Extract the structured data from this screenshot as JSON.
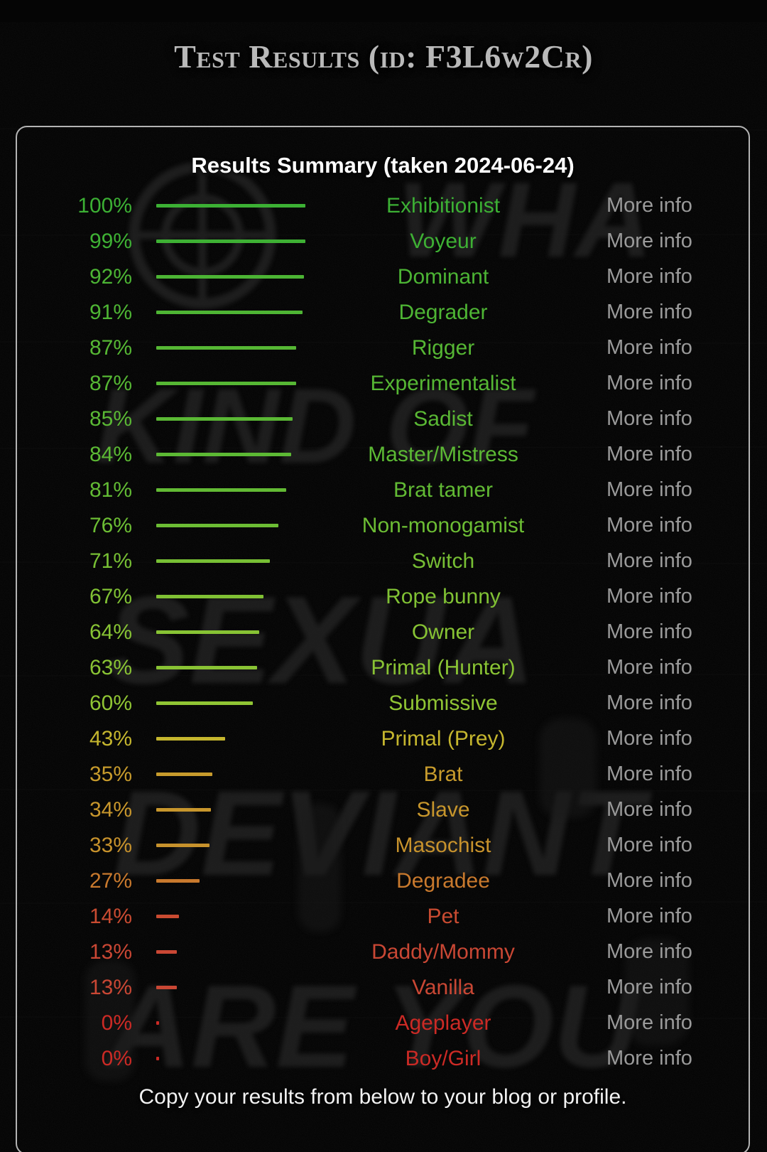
{
  "page": {
    "title": "Test Results (id: F3L6w2Cr)",
    "summary_heading": "Results Summary (taken 2024-06-24)",
    "footer_note": "Copy your results from below to your blog or profile.",
    "more_info_label": "More info"
  },
  "colors": {
    "title_text": "#b9b9b9",
    "card_border": "#b3b3b3",
    "heading_text": "#ffffff",
    "more_info_text": "#9a9a9a",
    "background": "#050505",
    "high": "#2fa12f",
    "mid": "#b8952a",
    "low": "#cc3327"
  },
  "chart_data": {
    "type": "bar",
    "title": "Results Summary (taken 2024-06-24)",
    "xlabel": "",
    "ylabel": "",
    "xlim": [
      0,
      100
    ],
    "grid": false,
    "legend": null,
    "orientation": "horizontal",
    "value_unit": "%",
    "categories": [
      "Exhibitionist",
      "Voyeur",
      "Dominant",
      "Degrader",
      "Rigger",
      "Experimentalist",
      "Sadist",
      "Master/Mistress",
      "Brat tamer",
      "Non-monogamist",
      "Switch",
      "Rope bunny",
      "Owner",
      "Primal (Hunter)",
      "Submissive",
      "Primal (Prey)",
      "Brat",
      "Slave",
      "Masochist",
      "Degradee",
      "Pet",
      "Daddy/Mommy",
      "Vanilla",
      "Ageplayer",
      "Boy/Girl"
    ],
    "values": [
      100,
      99,
      92,
      91,
      87,
      87,
      85,
      84,
      81,
      76,
      71,
      67,
      64,
      63,
      60,
      43,
      35,
      34,
      33,
      27,
      14,
      13,
      13,
      0,
      0
    ]
  },
  "rows": [
    {
      "pct": "100%",
      "value": 100,
      "label": "Exhibitionist",
      "more_info": "More info",
      "color": "#3cb034"
    },
    {
      "pct": "99%",
      "value": 99,
      "label": "Voyeur",
      "more_info": "More info",
      "color": "#3eb134"
    },
    {
      "pct": "92%",
      "value": 92,
      "label": "Dominant",
      "more_info": "More info",
      "color": "#4cb434"
    },
    {
      "pct": "91%",
      "value": 91,
      "label": "Degrader",
      "more_info": "More info",
      "color": "#4eb534"
    },
    {
      "pct": "87%",
      "value": 87,
      "label": "Rigger",
      "more_info": "More info",
      "color": "#56b734"
    },
    {
      "pct": "87%",
      "value": 87,
      "label": "Experimentalist",
      "more_info": "More info",
      "color": "#56b734"
    },
    {
      "pct": "85%",
      "value": 85,
      "label": "Sadist",
      "more_info": "More info",
      "color": "#5ab834"
    },
    {
      "pct": "84%",
      "value": 84,
      "label": "Master/Mistress",
      "more_info": "More info",
      "color": "#5cb934"
    },
    {
      "pct": "81%",
      "value": 81,
      "label": "Brat tamer",
      "more_info": "More info",
      "color": "#62ba34"
    },
    {
      "pct": "76%",
      "value": 76,
      "label": "Non-monogamist",
      "more_info": "More info",
      "color": "#6cbd34"
    },
    {
      "pct": "71%",
      "value": 71,
      "label": "Switch",
      "more_info": "More info",
      "color": "#77bf34"
    },
    {
      "pct": "67%",
      "value": 67,
      "label": "Rope bunny",
      "more_info": "More info",
      "color": "#80c134"
    },
    {
      "pct": "64%",
      "value": 64,
      "label": "Owner",
      "more_info": "More info",
      "color": "#87c334"
    },
    {
      "pct": "63%",
      "value": 63,
      "label": "Primal (Hunter)",
      "more_info": "More info",
      "color": "#89c334"
    },
    {
      "pct": "60%",
      "value": 60,
      "label": "Submissive",
      "more_info": "More info",
      "color": "#90c534"
    },
    {
      "pct": "43%",
      "value": 43,
      "label": "Primal (Prey)",
      "more_info": "More info",
      "color": "#c5b62e"
    },
    {
      "pct": "35%",
      "value": 35,
      "label": "Brat",
      "more_info": "More info",
      "color": "#c79b2c"
    },
    {
      "pct": "34%",
      "value": 34,
      "label": "Slave",
      "more_info": "More info",
      "color": "#c7962c"
    },
    {
      "pct": "33%",
      "value": 33,
      "label": "Masochist",
      "more_info": "More info",
      "color": "#c7922c"
    },
    {
      "pct": "27%",
      "value": 27,
      "label": "Degradee",
      "more_info": "More info",
      "color": "#c8792d"
    },
    {
      "pct": "14%",
      "value": 14,
      "label": "Pet",
      "more_info": "More info",
      "color": "#c94b31"
    },
    {
      "pct": "13%",
      "value": 13,
      "label": "Daddy/Mommy",
      "more_info": "More info",
      "color": "#c94734"
    },
    {
      "pct": "13%",
      "value": 13,
      "label": "Vanilla",
      "more_info": "More info",
      "color": "#c94734"
    },
    {
      "pct": "0%",
      "value": 0,
      "label": "Ageplayer",
      "more_info": "More info",
      "color": "#cc2a25"
    },
    {
      "pct": "0%",
      "value": 0,
      "label": "Boy/Girl",
      "more_info": "More info",
      "color": "#cc2a25"
    }
  ]
}
